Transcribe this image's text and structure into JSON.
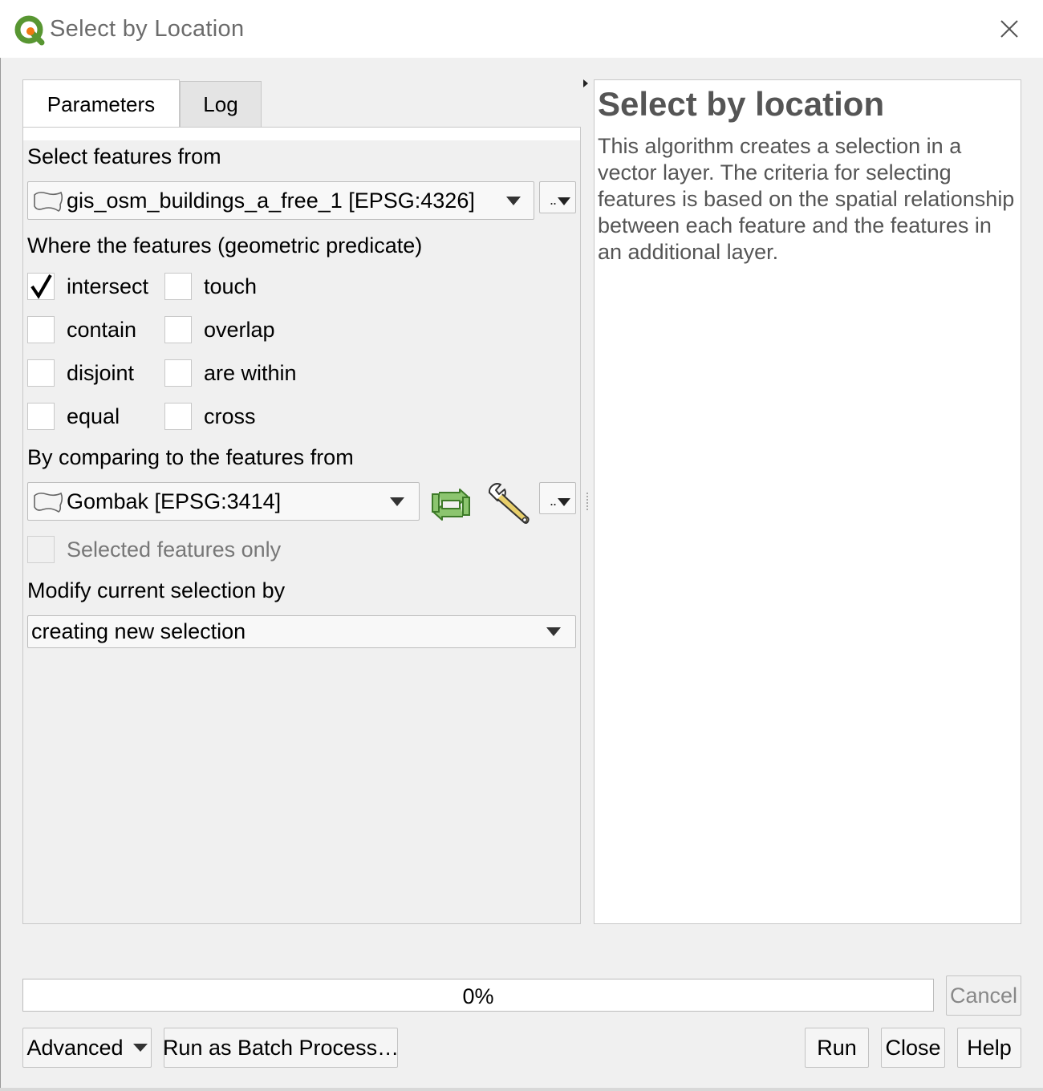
{
  "window": {
    "title": "Select by Location"
  },
  "tabs": [
    {
      "label": "Parameters",
      "active": true
    },
    {
      "label": "Log",
      "active": false
    }
  ],
  "params": {
    "input_label": "Select features from",
    "input_layer": "gis_osm_buildings_a_free_1 [EPSG:4326]",
    "predicate_label": "Where the features (geometric predicate)",
    "predicates": [
      {
        "label": "intersect",
        "checked": true
      },
      {
        "label": "touch",
        "checked": false
      },
      {
        "label": "contain",
        "checked": false
      },
      {
        "label": "overlap",
        "checked": false
      },
      {
        "label": "disjoint",
        "checked": false
      },
      {
        "label": "are within",
        "checked": false
      },
      {
        "label": "equal",
        "checked": false
      },
      {
        "label": "cross",
        "checked": false
      }
    ],
    "compare_label": "By comparing to the features from",
    "compare_layer": "Gombak [EPSG:3414]",
    "selected_only_label": "Selected features only",
    "selected_only_checked": false,
    "modify_label": "Modify current selection by",
    "modify_value": "creating new selection",
    "dots": ".."
  },
  "help": {
    "title": "Select by location",
    "body": "This algorithm creates a selection in a vector layer. The criteria for selecting features is based on the spatial relationship between each feature and the features in an additional layer."
  },
  "progress": {
    "value": 0,
    "text": "0%"
  },
  "buttons": {
    "cancel": "Cancel",
    "advanced": "Advanced",
    "batch": "Run as Batch Process…",
    "run": "Run",
    "close": "Close",
    "help": "Help"
  },
  "icons": {
    "app": "qgis-logo-icon",
    "close": "close-icon",
    "layer": "polygon-layer-icon",
    "iterate": "iterate-icon",
    "settings": "wrench-icon"
  },
  "colors": {
    "qgis_green": "#589632",
    "qgis_yellow": "#ee7913",
    "help_text": "#555555"
  }
}
